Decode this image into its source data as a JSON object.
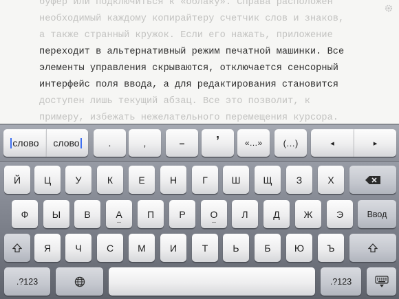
{
  "document": {
    "lines": [
      {
        "text": "буфер или подключиться к «облаку». Справа расположен",
        "active": false
      },
      {
        "text": "необходимый каждому копирайтеру счетчик слов и знаков,",
        "active": false
      },
      {
        "text": "а также странный кружок. Если его нажать, приложение",
        "active": false
      },
      {
        "text": "переходит в альтернативный режим печатной машинки. Все",
        "active": true
      },
      {
        "text": "элементы управления скрываются, отключается сенсорный",
        "active": true
      },
      {
        "text": "интерфейс поля ввода, а для редактирования становится",
        "active": true
      },
      {
        "text": "доступен лишь текущий абзац. Все это позволит, к",
        "active": false
      },
      {
        "text": "примеру, избежать нежелательного перемещения курсора.",
        "active": false
      }
    ]
  },
  "extra_row": {
    "word_left": "слово",
    "word_right": "слово",
    "period": ".",
    "comma": ",",
    "dash": "–",
    "apostrophe": "’",
    "guillemets": "«…»",
    "parens": "(…)",
    "left_arrow": "◂",
    "right_arrow": "▸"
  },
  "keyboard": {
    "row1": [
      "Й",
      "Ц",
      "У",
      "К",
      "Е",
      "Н",
      "Г",
      "Ш",
      "Щ",
      "З",
      "Х"
    ],
    "row2": [
      "Ф",
      "Ы",
      "В",
      "А",
      "П",
      "Р",
      "О",
      "Л",
      "Д",
      "Ж",
      "Э"
    ],
    "row3": [
      "Я",
      "Ч",
      "С",
      "М",
      "И",
      "Т",
      "Ь",
      "Б",
      "Ю",
      "Ъ"
    ],
    "return_label": "Ввод",
    "numbers_label": ".?123",
    "icons": {
      "backspace": "backspace-icon",
      "shift": "shift-icon",
      "globe": "globe-icon",
      "hide_keyboard": "keyboard-hide-icon",
      "settings": "gear-icon"
    }
  }
}
